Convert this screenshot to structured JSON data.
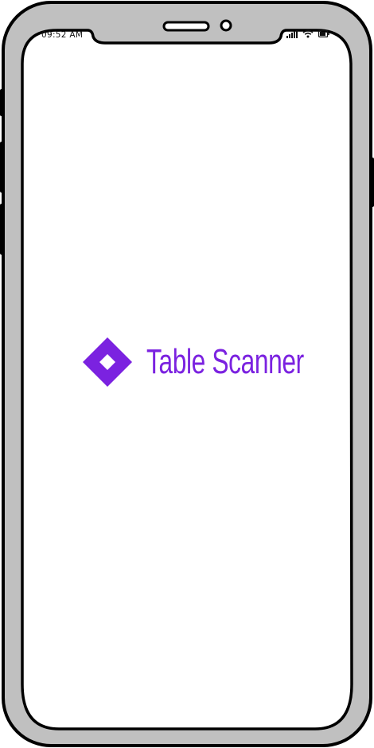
{
  "status_bar": {
    "time": "09:52 AM",
    "icons": [
      "signal-icon",
      "wifi-icon",
      "battery-icon"
    ]
  },
  "splash": {
    "logo_icon": "diamond-logo-icon",
    "app_name": "Table Scanner",
    "accent_color": "#7b22e0"
  },
  "frame": {
    "bezel_color": "#c0c0c0",
    "outline_color": "#000000"
  }
}
